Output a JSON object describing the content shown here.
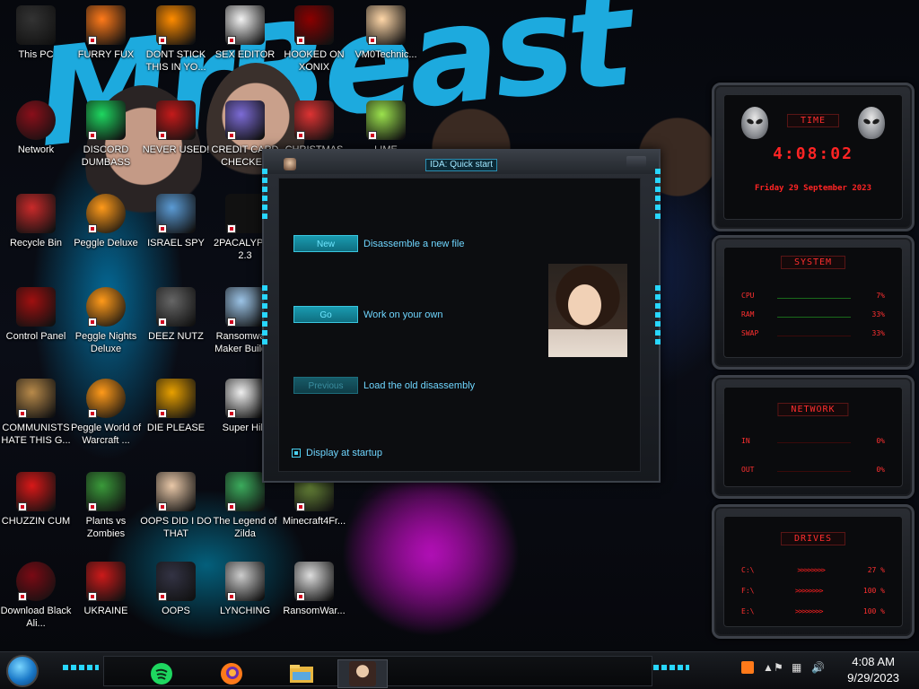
{
  "desktop": {
    "icons": [
      {
        "label": "This PC",
        "icon": "this-pc-icon"
      },
      {
        "label": "FURRY FUX",
        "icon": "firefox-icon"
      },
      {
        "label": "DONT STICK THIS IN YO...",
        "icon": "vlc-icon"
      },
      {
        "label": "SEX EDITOR",
        "icon": "hex-editor-icon"
      },
      {
        "label": "HOOKED ON XONIX",
        "icon": "xonix-game-icon"
      },
      {
        "label": "VM0Technic...",
        "icon": "doctor-icon"
      },
      {
        "label": "Network",
        "icon": "network-icon"
      },
      {
        "label": "DISCORD DUMBASS",
        "icon": "discord-icon"
      },
      {
        "label": "NEVER USED!",
        "icon": "devcpp-icon"
      },
      {
        "label": "CREDIT CARD CHECKER",
        "icon": "credit-card-icon"
      },
      {
        "label": "CHRISTMAS",
        "icon": "santa-icon"
      },
      {
        "label": "LIME",
        "icon": "lime-icon"
      },
      {
        "label": "Recycle Bin",
        "icon": "recycle-bin-icon"
      },
      {
        "label": "Peggle Deluxe",
        "icon": "peggle-icon"
      },
      {
        "label": "ISRAEL SPY",
        "icon": "spy-icon"
      },
      {
        "label": "2PACALYPSE 2.3",
        "icon": "console-icon"
      },
      {
        "label": "Control Panel",
        "icon": "control-panel-icon"
      },
      {
        "label": "Peggle Nights Deluxe",
        "icon": "peggle-icon"
      },
      {
        "label": "DEEZ NUTZ",
        "icon": "windows-stack-icon"
      },
      {
        "label": "Ransomware Maker Builder",
        "icon": "ransomware-builder-icon"
      },
      {
        "label": "COMMUNISTS HATE THIS G...",
        "icon": "money-bag-icon"
      },
      {
        "label": "Peggle World of Warcraft ...",
        "icon": "peggle-icon"
      },
      {
        "label": "DIE PLEASE",
        "icon": "dreamweaver-icon"
      },
      {
        "label": "Super Hiki",
        "icon": "pixel-game-icon"
      },
      {
        "label": "CHUZZIN CUM",
        "icon": "chuzzle-icon"
      },
      {
        "label": "Plants vs Zombies",
        "icon": "plants-icon"
      },
      {
        "label": "OOPS DID I DO THAT",
        "icon": "portrait-icon"
      },
      {
        "label": "The Legend of Zilda",
        "icon": "zelda-icon"
      },
      {
        "label": "Minecraft4Fr...",
        "icon": "minecraft-icon"
      },
      {
        "label": "Download Black Ali...",
        "icon": "alien-icon"
      },
      {
        "label": "UKRAINE",
        "icon": "radiation-icon"
      },
      {
        "label": "OOPS",
        "icon": "computer-icon"
      },
      {
        "label": "LYNCHING",
        "icon": "rope-icon"
      },
      {
        "label": "RansomWar...",
        "icon": "skull-icon"
      }
    ]
  },
  "ida": {
    "title": "IDA: Quick start",
    "buttons": [
      {
        "label": "New",
        "desc": "Disassemble a new file",
        "enabled": true
      },
      {
        "label": "Go",
        "desc": "Work on your own",
        "enabled": true
      },
      {
        "label": "Previous",
        "desc": "Load the old disassembly",
        "enabled": false
      }
    ],
    "checkbox_label": "Display at startup",
    "checkbox_checked": true
  },
  "widgets": {
    "time": {
      "header": "TIME",
      "clock": "4:08:02",
      "date": "Friday 29 September 2023"
    },
    "system": {
      "header": "SYSTEM",
      "rows": [
        {
          "label": "CPU",
          "value": "7%"
        },
        {
          "label": "RAM",
          "value": "33%"
        },
        {
          "label": "SWAP",
          "value": "33%"
        }
      ]
    },
    "network": {
      "header": "NETWORK",
      "rows": [
        {
          "label": "IN",
          "value": "0%"
        },
        {
          "label": "OUT",
          "value": "0%"
        }
      ]
    },
    "drives": {
      "header": "DRIVES",
      "rows": [
        {
          "label": "C:\\",
          "value": "27 %"
        },
        {
          "label": "F:\\",
          "value": "100 %"
        },
        {
          "label": "E:\\",
          "value": "100 %"
        }
      ]
    }
  },
  "taskbar": {
    "clock_time": "4:08 AM",
    "clock_date": "9/29/2023",
    "pinned": [
      "spotify-icon",
      "firefox-icon",
      "file-explorer-icon",
      "ida-portrait-icon"
    ]
  },
  "colors": {
    "accent_cyan": "#28d6ff",
    "widget_red": "#ff2424",
    "wallpaper_blue": "#1fb3ea"
  }
}
